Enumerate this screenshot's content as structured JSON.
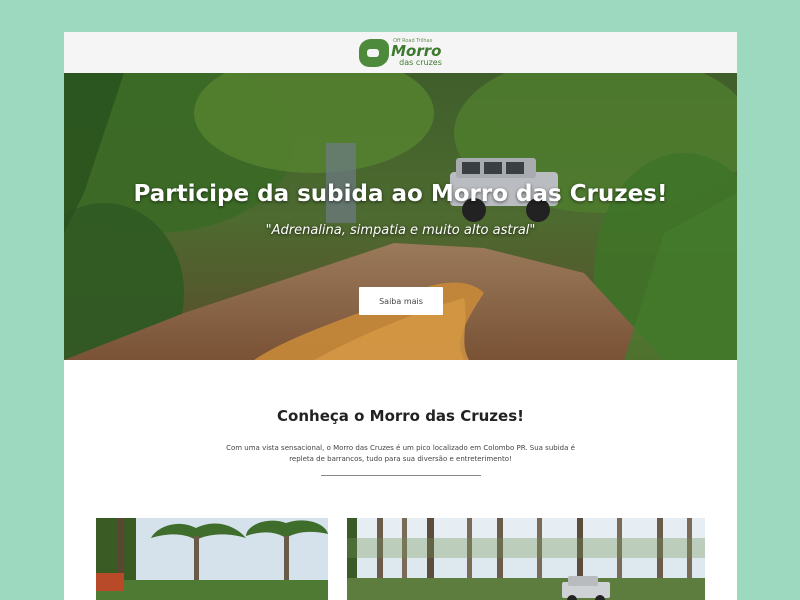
{
  "header": {
    "logo_small": "Off Road Trilhas",
    "logo_main": "Morro",
    "logo_sub": "das cruzes"
  },
  "hero": {
    "title": "Participe da subida ao Morro das Cruzes!",
    "subtitle": "\"Adrenalina, simpatia e muito alto astral\"",
    "button_label": "Saiba mais"
  },
  "intro": {
    "heading": "Conheça o Morro das Cruzes!",
    "body": "Com uma vista sensacional, o Morro das Cruzes é um pico localizado em Colombo PR. Sua subida é repleta de barrancos, tudo para sua diversão e entreterimento!"
  },
  "colors": {
    "background": "#9dd9bf",
    "brand_green": "#3d7a2f",
    "page": "#ffffff"
  }
}
